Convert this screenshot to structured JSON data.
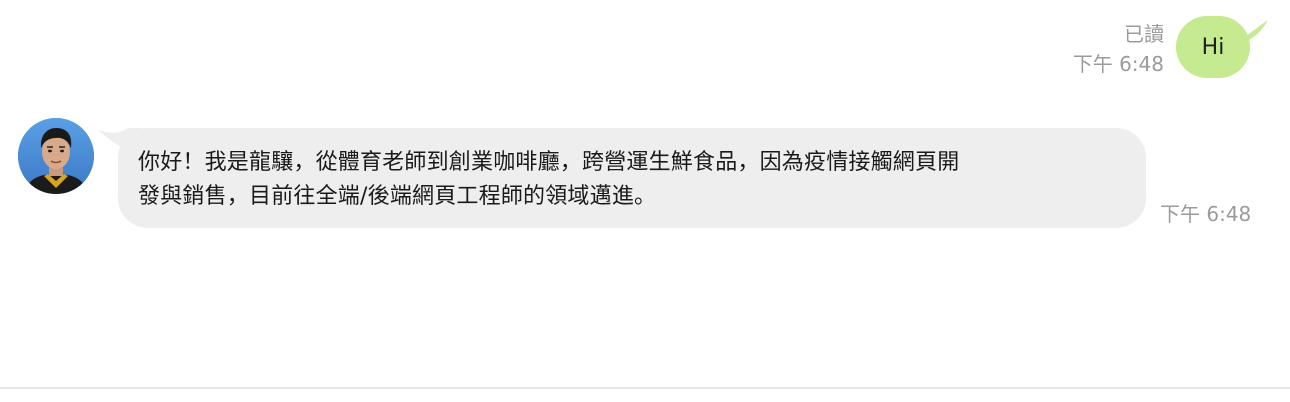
{
  "outgoing": {
    "read_status": "已讀",
    "time": "下午 6:48",
    "text": "Hi",
    "bubble_color": "#c6ea8f"
  },
  "incoming": {
    "avatar_icon": "person-avatar-icon",
    "lines": [
      "你好！我是龍驤，從體育老師到創業咖啡廳，跨營運生鮮食品，因為疫情接觸網頁開",
      "發與銷售，目前往全端/後端網頁工程師的領域邁進。"
    ],
    "time": "下午 6:48",
    "bubble_color": "#eeeeee"
  }
}
